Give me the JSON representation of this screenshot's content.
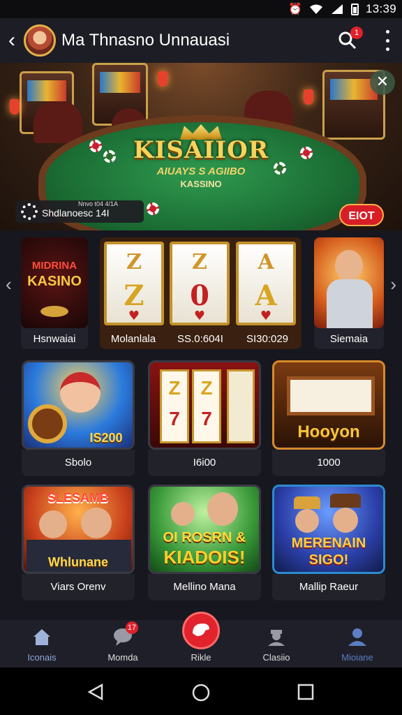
{
  "status_bar": {
    "time": "13:39"
  },
  "header": {
    "title": "Ma Thnasno Unnauasi",
    "notification_count": "1"
  },
  "banner": {
    "logo_line1": "KISAIIOR",
    "logo_line2": "AIUAYS S AGIIBO",
    "logo_line3": "KASSINO",
    "info_small": "Nnvo t04 4/1A",
    "info_big": "Shdlanoesc 14I",
    "bet_button": "EIOT"
  },
  "carousel": {
    "items": [
      {
        "label": "Hsnwaiai",
        "thumb_title1": "MIDRINA",
        "thumb_title2": "KASINO"
      },
      {
        "label": "Molanlala",
        "reel_symbols": [
          "Z",
          "Z"
        ]
      },
      {
        "label": "SS.0:604I",
        "reel_symbols": [
          "Z",
          "0"
        ]
      },
      {
        "label": "SI30:029",
        "reel_symbols": [
          "A",
          "A"
        ]
      },
      {
        "label": "Siemaia"
      }
    ]
  },
  "grid": {
    "items": [
      {
        "caption": "Sbolo",
        "overlay": "IS200"
      },
      {
        "caption": "I6i00",
        "reel_symbols": [
          "Z",
          "7",
          "Z",
          "7"
        ]
      },
      {
        "caption": "1000",
        "overlay": "Hooyon"
      },
      {
        "caption": "Viars Orenv",
        "overlay_top": "SLESAMB",
        "overlay_bottom": "Whlunane"
      },
      {
        "caption": "Mellino Mana",
        "overlay_top": "OI ROSRN &",
        "overlay_bottom": "KIADOIS!"
      },
      {
        "caption": "Mallip Raeur",
        "overlay_top": "MERENAIN",
        "overlay_bottom": "SIGO!"
      }
    ]
  },
  "bottom_nav": {
    "items": [
      {
        "label": "Iconais",
        "icon": "home-icon"
      },
      {
        "label": "Momda",
        "icon": "chat-icon",
        "badge": "17"
      },
      {
        "label": "Rikle",
        "icon": "center-action-icon"
      },
      {
        "label": "Clasiio",
        "icon": "dealer-icon"
      },
      {
        "label": "Mioiane",
        "icon": "profile-icon"
      }
    ]
  },
  "colors": {
    "accent_red": "#e0232c",
    "gold": "#e8b531",
    "felt_green": "#1c6f35"
  }
}
